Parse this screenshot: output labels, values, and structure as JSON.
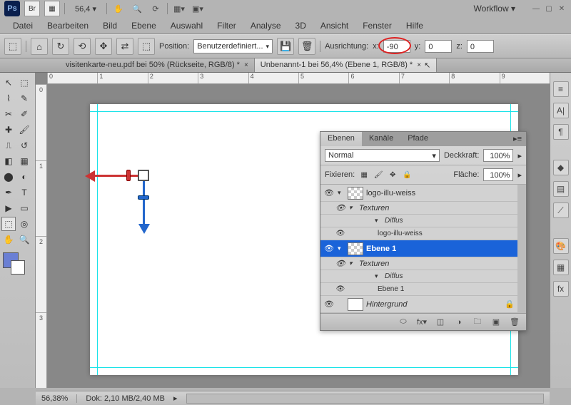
{
  "app": {
    "ps": "Ps",
    "br": "Br",
    "mb": "▦",
    "zoom": "56,4 ▾",
    "workflow": "Workflow ▾"
  },
  "menu": [
    "Datei",
    "Bearbeiten",
    "Bild",
    "Ebene",
    "Auswahl",
    "Filter",
    "Analyse",
    "3D",
    "Ansicht",
    "Fenster",
    "Hilfe"
  ],
  "opt": {
    "position_label": "Position:",
    "position_value": "Benutzerdefiniert...",
    "ausrichtung_label": "Ausrichtung:",
    "x_label": "x:",
    "x_value": "-90",
    "y_label": "y:",
    "y_value": "0",
    "z_label": "z:",
    "z_value": "0"
  },
  "tabs": [
    {
      "label": "visitenkarte-neu.pdf bei 50% (Rückseite, RGB/8) *",
      "active": false
    },
    {
      "label": "Unbenannt-1 bei 56,4% (Ebene 1, RGB/8) *",
      "active": true
    }
  ],
  "ruler_h": [
    "0",
    "1",
    "2",
    "3",
    "4",
    "5",
    "6",
    "7",
    "8",
    "9"
  ],
  "ruler_v": [
    "0",
    "1",
    "2",
    "3"
  ],
  "layers": {
    "tabs": [
      "Ebenen",
      "Kanäle",
      "Pfade"
    ],
    "blend": "Normal",
    "opacity_label": "Deckkraft:",
    "opacity": "100%",
    "lock_label": "Fixieren:",
    "fill_label": "Fläche:",
    "fill": "100%",
    "items": [
      {
        "name": "logo-illu-weiss",
        "sel": false,
        "thumb": "checker"
      },
      {
        "name": "Texturen",
        "sub": true
      },
      {
        "name": "Diffus",
        "sub2": true,
        "italic": true
      },
      {
        "name": "logo-illu-weiss",
        "sub2": true
      },
      {
        "name": "Ebene 1",
        "sel": true,
        "thumb": "checker"
      },
      {
        "name": "Texturen",
        "sub": true
      },
      {
        "name": "Diffus",
        "sub2": true,
        "italic": true
      },
      {
        "name": "Ebene 1",
        "sub2": true
      },
      {
        "name": "Hintergrund",
        "sel": false,
        "thumb": "solid",
        "locked": true
      }
    ]
  },
  "status": {
    "zoom": "56,38%",
    "doc": "Dok: 2,10 MB/2,40 MB"
  }
}
